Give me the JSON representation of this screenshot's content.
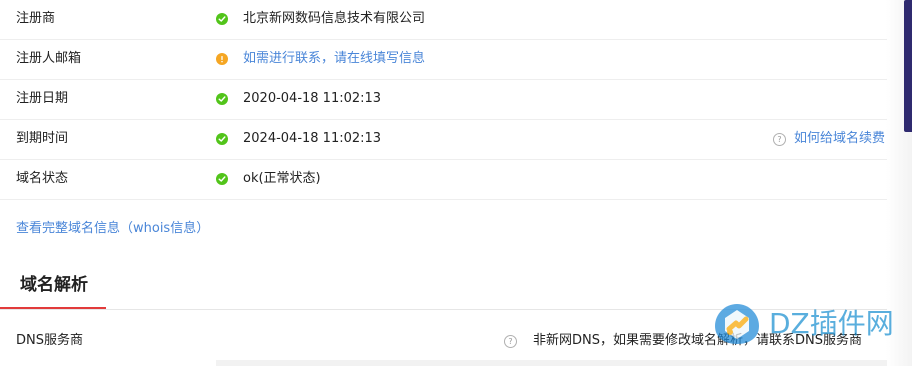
{
  "rows": [
    {
      "label": "注册商",
      "value": "北京新网数码信息技术有限公司",
      "status": "ok",
      "value_is_link": false
    },
    {
      "label": "注册人邮箱",
      "value": "如需进行联系，请在线填写信息",
      "status": "warn",
      "value_is_link": true
    },
    {
      "label": "注册日期",
      "value": "2020-04-18 11:02:13",
      "status": "ok",
      "value_is_link": false
    },
    {
      "label": "到期时间",
      "value": "2024-04-18 11:02:13",
      "status": "ok",
      "value_is_link": false,
      "action": "如何给域名续费"
    },
    {
      "label": "域名状态",
      "value": "ok(正常状态)",
      "status": "ok",
      "value_is_link": false
    }
  ],
  "links": {
    "whois": "查看完整域名信息（whois信息）"
  },
  "section": {
    "title": "域名解析"
  },
  "dns": {
    "label": "DNS服务商",
    "note": "非新网DNS，如果需要修改域名解析，请联系DNS服务商"
  },
  "watermark": {
    "text": "DZ插件网"
  },
  "colors": {
    "ok": "#52c41a",
    "warn": "#f5a623",
    "link": "#4a86d8",
    "accent": "#e23b3b"
  }
}
